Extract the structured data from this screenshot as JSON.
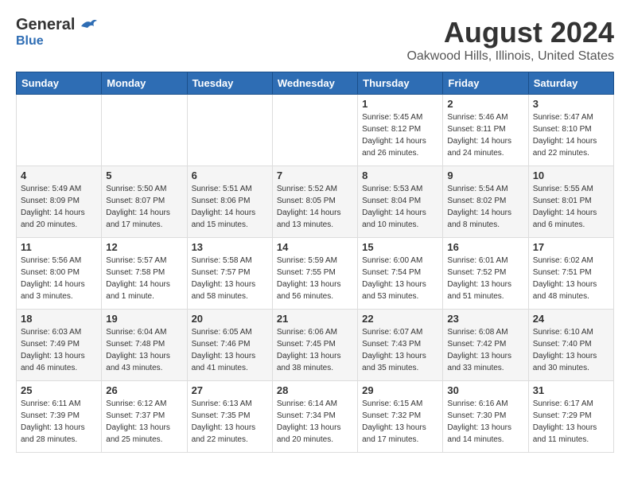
{
  "header": {
    "logo_general": "General",
    "logo_blue": "Blue",
    "title": "August 2024",
    "subtitle": "Oakwood Hills, Illinois, United States"
  },
  "columns": [
    "Sunday",
    "Monday",
    "Tuesday",
    "Wednesday",
    "Thursday",
    "Friday",
    "Saturday"
  ],
  "weeks": [
    {
      "days": [
        {
          "num": "",
          "info": ""
        },
        {
          "num": "",
          "info": ""
        },
        {
          "num": "",
          "info": ""
        },
        {
          "num": "",
          "info": ""
        },
        {
          "num": "1",
          "info": "Sunrise: 5:45 AM\nSunset: 8:12 PM\nDaylight: 14 hours\nand 26 minutes."
        },
        {
          "num": "2",
          "info": "Sunrise: 5:46 AM\nSunset: 8:11 PM\nDaylight: 14 hours\nand 24 minutes."
        },
        {
          "num": "3",
          "info": "Sunrise: 5:47 AM\nSunset: 8:10 PM\nDaylight: 14 hours\nand 22 minutes."
        }
      ]
    },
    {
      "days": [
        {
          "num": "4",
          "info": "Sunrise: 5:49 AM\nSunset: 8:09 PM\nDaylight: 14 hours\nand 20 minutes."
        },
        {
          "num": "5",
          "info": "Sunrise: 5:50 AM\nSunset: 8:07 PM\nDaylight: 14 hours\nand 17 minutes."
        },
        {
          "num": "6",
          "info": "Sunrise: 5:51 AM\nSunset: 8:06 PM\nDaylight: 14 hours\nand 15 minutes."
        },
        {
          "num": "7",
          "info": "Sunrise: 5:52 AM\nSunset: 8:05 PM\nDaylight: 14 hours\nand 13 minutes."
        },
        {
          "num": "8",
          "info": "Sunrise: 5:53 AM\nSunset: 8:04 PM\nDaylight: 14 hours\nand 10 minutes."
        },
        {
          "num": "9",
          "info": "Sunrise: 5:54 AM\nSunset: 8:02 PM\nDaylight: 14 hours\nand 8 minutes."
        },
        {
          "num": "10",
          "info": "Sunrise: 5:55 AM\nSunset: 8:01 PM\nDaylight: 14 hours\nand 6 minutes."
        }
      ]
    },
    {
      "days": [
        {
          "num": "11",
          "info": "Sunrise: 5:56 AM\nSunset: 8:00 PM\nDaylight: 14 hours\nand 3 minutes."
        },
        {
          "num": "12",
          "info": "Sunrise: 5:57 AM\nSunset: 7:58 PM\nDaylight: 14 hours\nand 1 minute."
        },
        {
          "num": "13",
          "info": "Sunrise: 5:58 AM\nSunset: 7:57 PM\nDaylight: 13 hours\nand 58 minutes."
        },
        {
          "num": "14",
          "info": "Sunrise: 5:59 AM\nSunset: 7:55 PM\nDaylight: 13 hours\nand 56 minutes."
        },
        {
          "num": "15",
          "info": "Sunrise: 6:00 AM\nSunset: 7:54 PM\nDaylight: 13 hours\nand 53 minutes."
        },
        {
          "num": "16",
          "info": "Sunrise: 6:01 AM\nSunset: 7:52 PM\nDaylight: 13 hours\nand 51 minutes."
        },
        {
          "num": "17",
          "info": "Sunrise: 6:02 AM\nSunset: 7:51 PM\nDaylight: 13 hours\nand 48 minutes."
        }
      ]
    },
    {
      "days": [
        {
          "num": "18",
          "info": "Sunrise: 6:03 AM\nSunset: 7:49 PM\nDaylight: 13 hours\nand 46 minutes."
        },
        {
          "num": "19",
          "info": "Sunrise: 6:04 AM\nSunset: 7:48 PM\nDaylight: 13 hours\nand 43 minutes."
        },
        {
          "num": "20",
          "info": "Sunrise: 6:05 AM\nSunset: 7:46 PM\nDaylight: 13 hours\nand 41 minutes."
        },
        {
          "num": "21",
          "info": "Sunrise: 6:06 AM\nSunset: 7:45 PM\nDaylight: 13 hours\nand 38 minutes."
        },
        {
          "num": "22",
          "info": "Sunrise: 6:07 AM\nSunset: 7:43 PM\nDaylight: 13 hours\nand 35 minutes."
        },
        {
          "num": "23",
          "info": "Sunrise: 6:08 AM\nSunset: 7:42 PM\nDaylight: 13 hours\nand 33 minutes."
        },
        {
          "num": "24",
          "info": "Sunrise: 6:10 AM\nSunset: 7:40 PM\nDaylight: 13 hours\nand 30 minutes."
        }
      ]
    },
    {
      "days": [
        {
          "num": "25",
          "info": "Sunrise: 6:11 AM\nSunset: 7:39 PM\nDaylight: 13 hours\nand 28 minutes."
        },
        {
          "num": "26",
          "info": "Sunrise: 6:12 AM\nSunset: 7:37 PM\nDaylight: 13 hours\nand 25 minutes."
        },
        {
          "num": "27",
          "info": "Sunrise: 6:13 AM\nSunset: 7:35 PM\nDaylight: 13 hours\nand 22 minutes."
        },
        {
          "num": "28",
          "info": "Sunrise: 6:14 AM\nSunset: 7:34 PM\nDaylight: 13 hours\nand 20 minutes."
        },
        {
          "num": "29",
          "info": "Sunrise: 6:15 AM\nSunset: 7:32 PM\nDaylight: 13 hours\nand 17 minutes."
        },
        {
          "num": "30",
          "info": "Sunrise: 6:16 AM\nSunset: 7:30 PM\nDaylight: 13 hours\nand 14 minutes."
        },
        {
          "num": "31",
          "info": "Sunrise: 6:17 AM\nSunset: 7:29 PM\nDaylight: 13 hours\nand 11 minutes."
        }
      ]
    }
  ]
}
